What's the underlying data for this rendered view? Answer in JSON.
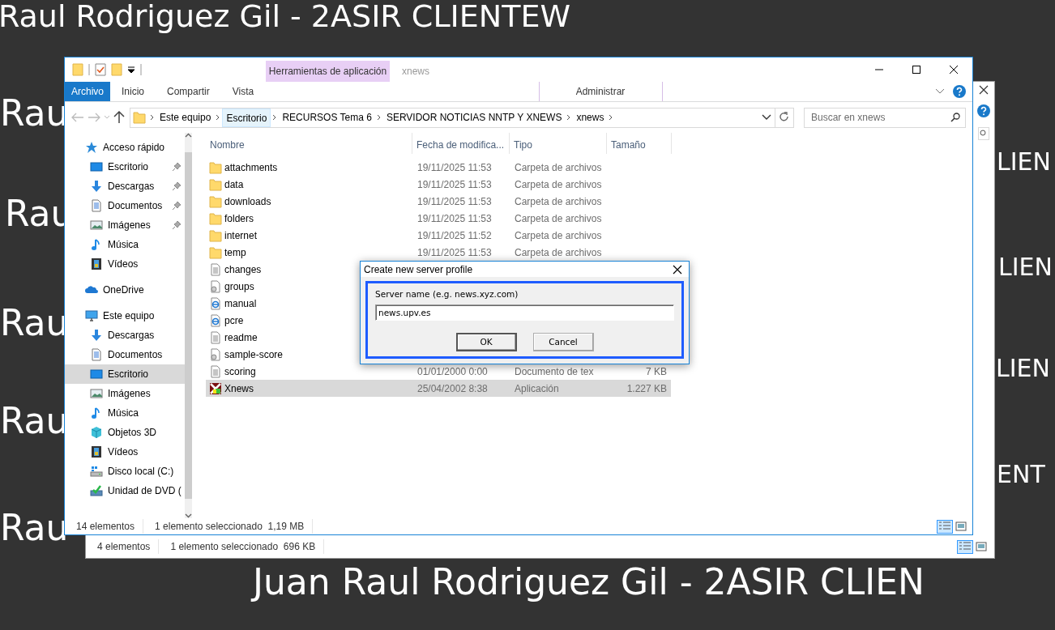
{
  "desktop": {
    "wallpaper_texts": [
      "Raul Rodriguez Gil - 2ASIR CLIENTEW",
      "Rau",
      "LIEN",
      "Rau",
      "LIEN",
      "Rau",
      "LIEN",
      "Rau",
      "ENT",
      "Rau",
      "Juan Raul Rodriguez Gil - 2ASIR CLIEN"
    ]
  },
  "back_window": {
    "status_bar": {
      "item_count": "4 elementos",
      "selection": "1 elemento seleccionado  696 KB"
    }
  },
  "window": {
    "title": "xnews",
    "contextual_group": "Herramientas de aplicación",
    "ribbon_tabs": [
      {
        "label": "Archivo",
        "kind": "file",
        "selected": false
      },
      {
        "label": "Inicio",
        "kind": "tab",
        "selected": false
      },
      {
        "label": "Compartir",
        "kind": "tab",
        "selected": false
      },
      {
        "label": "Vista",
        "kind": "tab",
        "selected": false
      },
      {
        "label": "Administrar",
        "kind": "contextual",
        "selected": false
      }
    ],
    "address_bar": {
      "segments": [
        {
          "label": "Este equipo",
          "hover": false
        },
        {
          "label": "Escritorio",
          "hover": true
        },
        {
          "label": "RECURSOS Tema 6",
          "hover": false
        },
        {
          "label": "SERVIDOR NOTICIAS NNTP Y XNEWS",
          "hover": false
        },
        {
          "label": "xnews",
          "hover": false
        }
      ]
    },
    "search": {
      "placeholder": "Buscar en xnews"
    },
    "nav_pane": {
      "items": [
        {
          "label": "Acceso rápido",
          "kind": "star",
          "selected": false,
          "children": [
            {
              "label": "Escritorio",
              "kind": "desktop",
              "pinned": true,
              "selected": false
            },
            {
              "label": "Descargas",
              "kind": "download",
              "pinned": true,
              "selected": false
            },
            {
              "label": "Documentos",
              "kind": "documents",
              "pinned": true,
              "selected": false
            },
            {
              "label": "Imágenes",
              "kind": "pictures",
              "pinned": true,
              "selected": false
            },
            {
              "label": "Música",
              "kind": "music",
              "pinned": false,
              "selected": false
            },
            {
              "label": "Vídeos",
              "kind": "videos",
              "pinned": false,
              "selected": false
            }
          ]
        },
        {
          "label": "OneDrive",
          "kind": "cloud",
          "selected": false
        },
        {
          "label": "Este equipo",
          "kind": "computer",
          "selected": false,
          "children": [
            {
              "label": "Descargas",
              "kind": "download",
              "pinned": false,
              "selected": false
            },
            {
              "label": "Documentos",
              "kind": "documents",
              "pinned": false,
              "selected": false
            },
            {
              "label": "Escritorio",
              "kind": "desktop",
              "pinned": false,
              "selected": true
            },
            {
              "label": "Imágenes",
              "kind": "pictures",
              "pinned": false,
              "selected": false
            },
            {
              "label": "Música",
              "kind": "music",
              "pinned": false,
              "selected": false
            },
            {
              "label": "Objetos 3D",
              "kind": "cube",
              "pinned": false,
              "selected": false
            },
            {
              "label": "Vídeos",
              "kind": "videos",
              "pinned": false,
              "selected": false
            },
            {
              "label": "Disco local (C:)",
              "kind": "drive",
              "pinned": false,
              "selected": false
            },
            {
              "label": "Unidad de DVD (",
              "kind": "dvd",
              "pinned": false,
              "selected": false
            }
          ]
        }
      ]
    },
    "file_list": {
      "columns": [
        "Nombre",
        "Fecha de modifica...",
        "Tipo",
        "Tamaño"
      ],
      "rows": [
        {
          "name": "attachments",
          "kind": "folder",
          "date": "19/11/2025 11:53",
          "type": "Carpeta de archivos",
          "selected": false
        },
        {
          "name": "data",
          "kind": "folder",
          "date": "19/11/2025 11:53",
          "type": "Carpeta de archivos",
          "selected": false
        },
        {
          "name": "downloads",
          "kind": "folder",
          "date": "19/11/2025 11:53",
          "type": "Carpeta de archivos",
          "selected": false
        },
        {
          "name": "folders",
          "kind": "folder",
          "date": "19/11/2025 11:53",
          "type": "Carpeta de archivos",
          "selected": false
        },
        {
          "name": "internet",
          "kind": "folder",
          "date": "19/11/2025 11:52",
          "type": "Carpeta de archivos",
          "selected": false
        },
        {
          "name": "temp",
          "kind": "folder",
          "date": "19/11/2025 11:53",
          "type": "Carpeta de archivos",
          "selected": false
        },
        {
          "name": "changes",
          "kind": "text",
          "selected": false
        },
        {
          "name": "groups",
          "kind": "settings",
          "selected": false
        },
        {
          "name": "manual",
          "kind": "web",
          "selected": false
        },
        {
          "name": "pcre",
          "kind": "web",
          "selected": false
        },
        {
          "name": "readme",
          "kind": "text",
          "selected": false
        },
        {
          "name": "sample-score",
          "kind": "settings",
          "selected": false
        },
        {
          "name": "scoring",
          "kind": "text",
          "date": "01/01/2000 0:00",
          "type": "Documento de tex",
          "size": "7 KB",
          "selected": false
        },
        {
          "name": "Xnews",
          "kind": "app",
          "date": "25/04/2002 8:38",
          "type": "Aplicación",
          "size": "1.227 KB",
          "selected": true
        }
      ]
    },
    "status_bar": {
      "item_count": "14 elementos",
      "selection": "1 elemento seleccionado  1,19 MB"
    }
  },
  "dialog": {
    "title": "Create new server profile",
    "field_label": "Server name (e.g. news.xyz.com)",
    "value": "news.upv.es",
    "buttons": [
      {
        "label": "OK",
        "default": true
      },
      {
        "label": "Cancel",
        "default": false
      }
    ]
  }
}
